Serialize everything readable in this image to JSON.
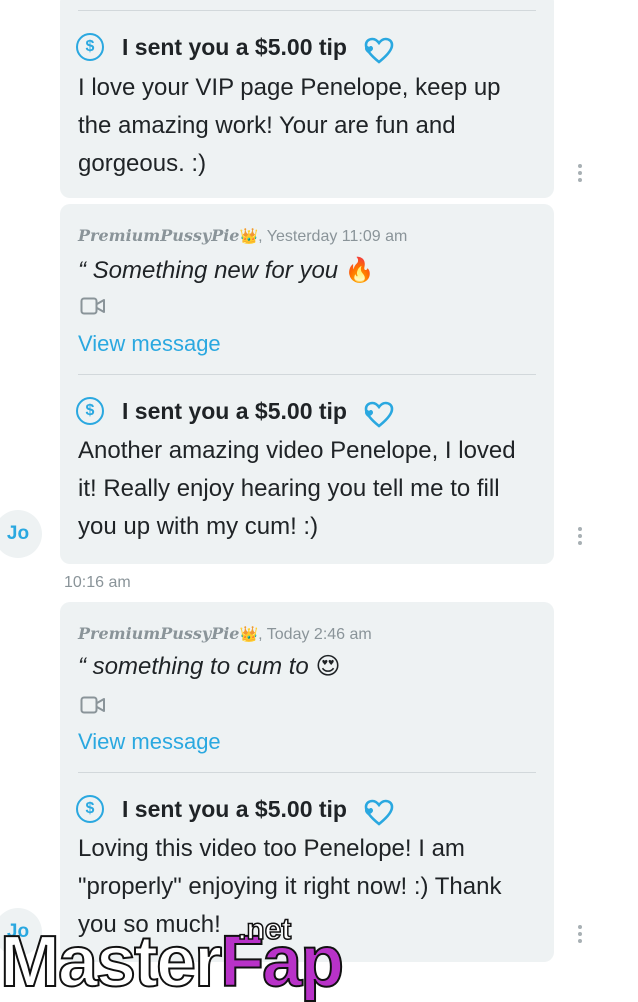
{
  "messages": [
    {
      "tip_label": "I sent you a $5.00 tip",
      "text": "I love your VIP page Penelope, keep up the amazing work! Your are fun and gorgeous. :)"
    },
    {
      "sender": "PremiumPussyPie",
      "time": ", Yesterday 11:09 am",
      "quote": "“ Something new for you",
      "emoji": "🔥",
      "view_label": "View message",
      "tip_label": "I sent you a $5.00 tip",
      "text": "Another amazing video Penelope, I loved it! Really enjoy hearing you tell me to fill you up with my cum! :)",
      "avatar": "Jo"
    },
    {
      "timestamp": "10:16 am",
      "sender": "PremiumPussyPie",
      "time": ", Today 2:46 am",
      "quote": "“ something to cum to",
      "emoji": "😍",
      "view_label": "View message",
      "tip_label": "I sent you a $5.00 tip",
      "text": "Loving this video too Penelope! I am \"properly\" enjoying it right now! :) Thank you so much!",
      "avatar": "Jo"
    }
  ],
  "watermark": {
    "master": "Master",
    "fap": "Fap",
    "net": ".net"
  },
  "colors": {
    "accent": "#2aa8e0",
    "bubble": "#eef2f3",
    "crown": "#e8a818"
  },
  "icons": [
    "dollar-icon",
    "heart-icon",
    "crown-icon",
    "video-icon",
    "more-icon"
  ]
}
